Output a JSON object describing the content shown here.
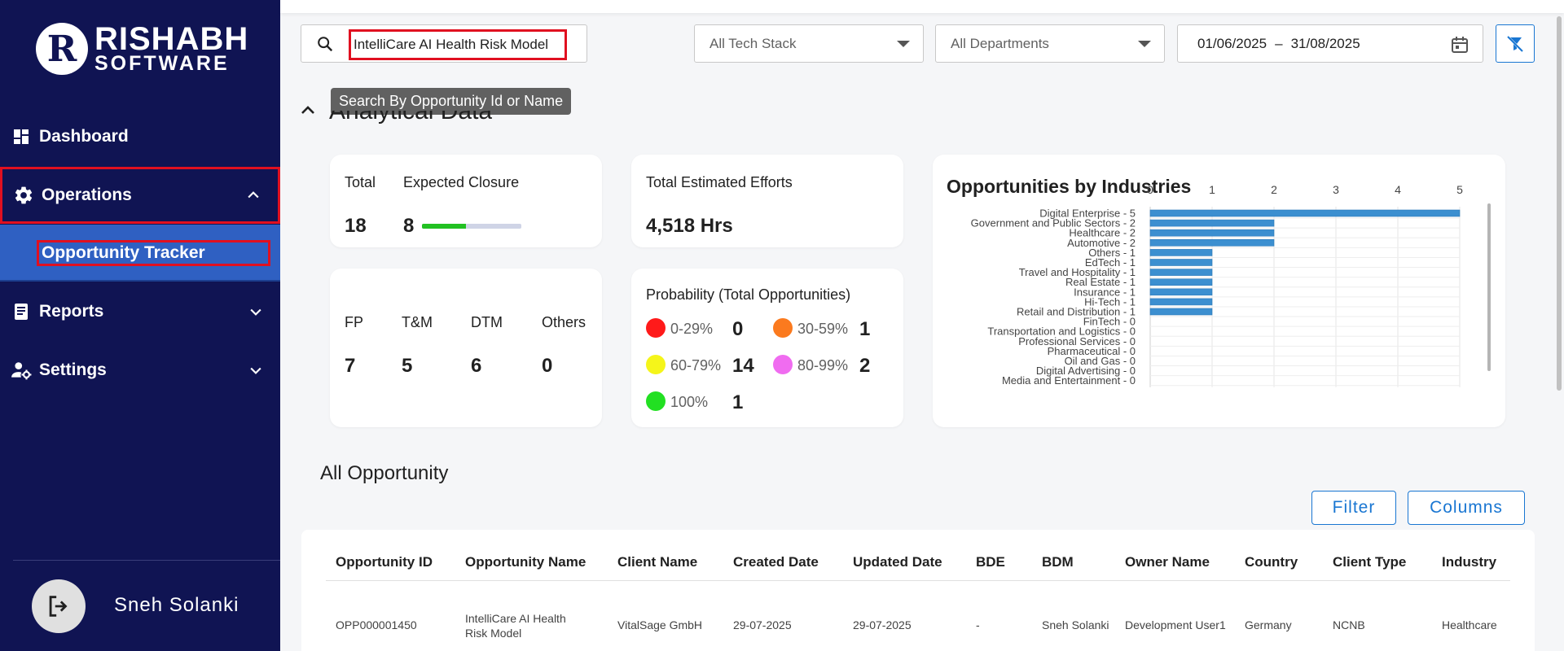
{
  "brand": {
    "line1": "RISHABH",
    "line2": "SOFTWARE",
    "mark": "R"
  },
  "sidebar": {
    "items": [
      {
        "label": "Dashboard",
        "icon": "dashboard-icon"
      },
      {
        "label": "Operations",
        "icon": "gear-icon",
        "expanded": true
      },
      {
        "label": "Reports",
        "icon": "report-icon"
      },
      {
        "label": "Settings",
        "icon": "user-settings-icon"
      }
    ],
    "sub_items": [
      {
        "label": "Opportunity Tracker",
        "active": true
      }
    ],
    "user_name": "Sneh Solanki"
  },
  "filters": {
    "search_value": "IntelliCare AI Health Risk Model",
    "search_tooltip": "Search By Opportunity Id or Name",
    "tech_stack": "All Tech Stack",
    "departments": "All Departments",
    "date_from": "01/06/2025",
    "date_sep": "–",
    "date_to": "31/08/2025"
  },
  "section_title": "Analytical Data",
  "stats": {
    "total_label": "Total",
    "total_value": "18",
    "closure_label": "Expected Closure",
    "closure_value": "8",
    "closure_progress": 0.44,
    "efforts_label": "Total Estimated Efforts",
    "efforts_value": "4,518 Hrs",
    "types": [
      {
        "label": "FP",
        "value": "7"
      },
      {
        "label": "T&M",
        "value": "5"
      },
      {
        "label": "DTM",
        "value": "6"
      },
      {
        "label": "Others",
        "value": "0"
      }
    ],
    "probability_title": "Probability (Total Opportunities)",
    "probability": [
      {
        "label": "0-29%",
        "value": "0",
        "color": "#ff1a1a"
      },
      {
        "label": "30-59%",
        "value": "1",
        "color": "#fb7a1e"
      },
      {
        "label": "60-79%",
        "value": "14",
        "color": "#f5f51a"
      },
      {
        "label": "80-99%",
        "value": "2",
        "color": "#f06cf0"
      },
      {
        "label": "100%",
        "value": "1",
        "color": "#22e022"
      }
    ]
  },
  "chart_data": {
    "type": "bar",
    "orientation": "horizontal",
    "title": "Opportunities by Industries",
    "categories": [
      "Digital Enterprise - 5",
      "Government and Public Sectors - 2",
      "Healthcare - 2",
      "Automotive - 2",
      "Others - 1",
      "EdTech - 1",
      "Travel and Hospitality - 1",
      "Real Estate - 1",
      "Insurance - 1",
      "Hi-Tech - 1",
      "Retail and Distribution - 1",
      "FinTech - 0",
      "Transportation and Logistics - 0",
      "Professional Services - 0",
      "Pharmaceutical - 0",
      "Oil and Gas - 0",
      "Digital Advertising - 0",
      "Media and Entertainment - 0"
    ],
    "values": [
      5,
      2,
      2,
      2,
      1,
      1,
      1,
      1,
      1,
      1,
      1,
      0,
      0,
      0,
      0,
      0,
      0,
      0
    ],
    "xlim": [
      0,
      5
    ],
    "xticks": [
      "0",
      "1",
      "2",
      "3",
      "4",
      "5"
    ],
    "bar_color": "#3c8fd0",
    "grid": true,
    "axis_position": "top"
  },
  "opportunities": {
    "title": "All Opportunity",
    "filter_label": "Filter",
    "columns_label": "Columns",
    "headers": [
      "Opportunity ID",
      "Opportunity Name",
      "Client Name",
      "Created Date",
      "Updated Date",
      "BDE",
      "BDM",
      "Owner Name",
      "Country",
      "Client Type",
      "Industry"
    ],
    "rows": [
      [
        "OPP000001450",
        "IntelliCare AI Health Risk Model",
        "VitalSage GmbH",
        "29-07-2025",
        "29-07-2025",
        "-",
        "Sneh Solanki",
        "Development User1",
        "Germany",
        "NCNB",
        "Healthcare"
      ]
    ]
  }
}
